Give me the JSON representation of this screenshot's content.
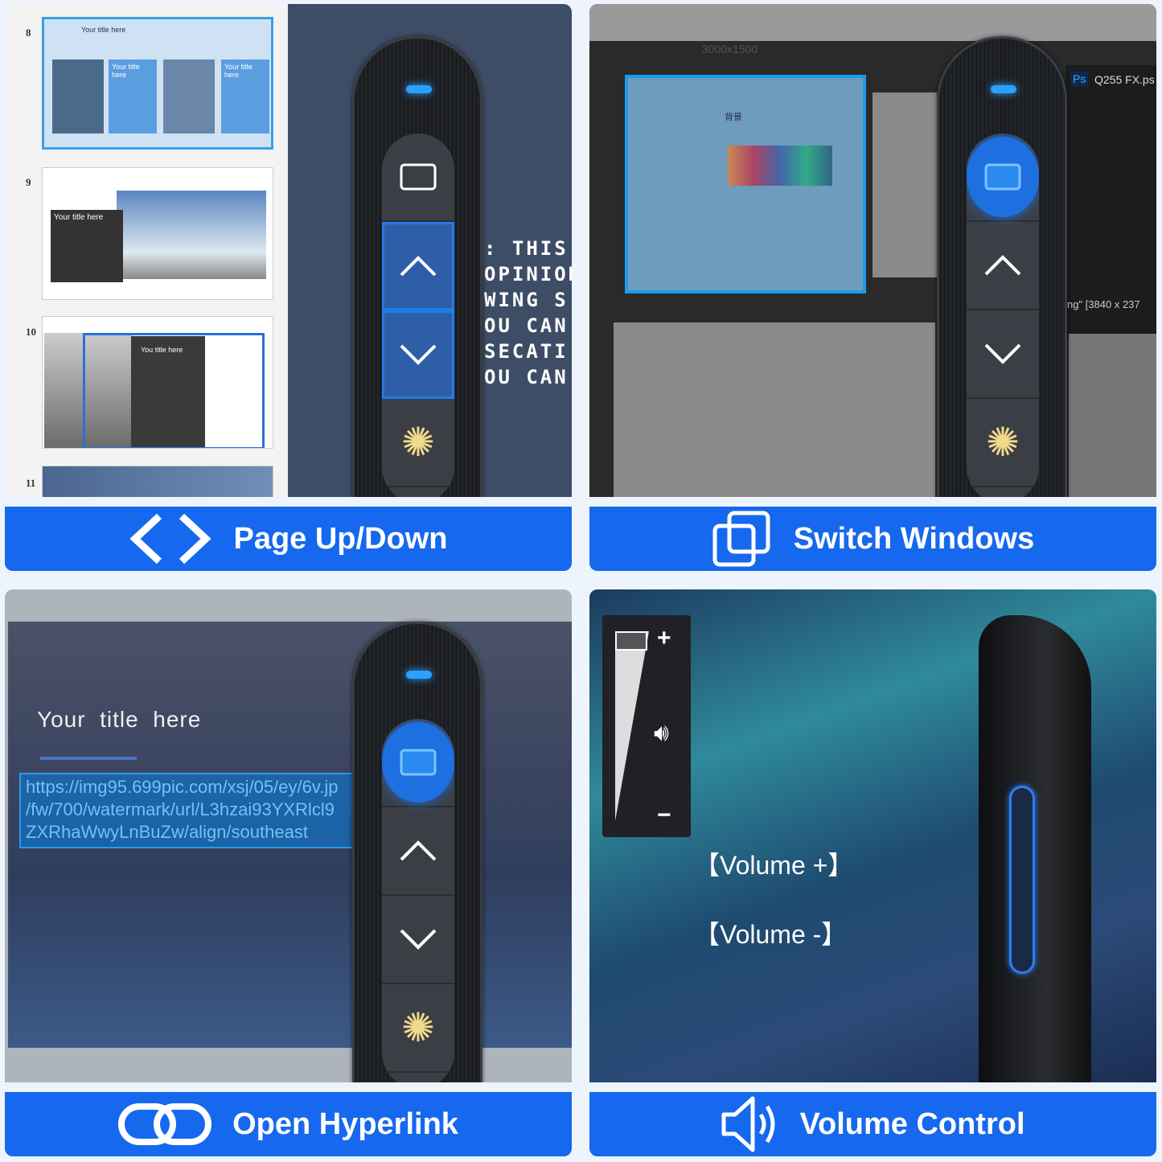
{
  "panels": {
    "page_updown": {
      "label": "Page Up/Down",
      "slide_numbers": [
        "8",
        "9",
        "10",
        "11"
      ],
      "slide8_title": "Your title here",
      "slide8_sub1": "Your title here",
      "slide8_sub2": "Your title here",
      "slide9_title": "Your title here",
      "slide10_title": "You title here",
      "background_text": [
        ": THIS F",
        "OPINION",
        "WING S",
        "OU CAN",
        "SECATI",
        "OU CAN"
      ]
    },
    "switch_windows": {
      "label": "Switch Windows",
      "resolution_text": "3000x1500",
      "ps_file": "Q255 FX.ps",
      "ps_badge": "Ps",
      "image_size": "ng\" [3840 x 237",
      "settings_heading": "背景"
    },
    "open_hyperlink": {
      "label": "Open Hyperlink",
      "slide_title": "Your  title  here",
      "url_lines": [
        "https://img95.699pic.com/xsj/05/ey/6v.jp",
        "/fw/700/watermark/url/L3hzai93YXRlcl9",
        "ZXRhaWwyLnBuZw/align/southeast"
      ]
    },
    "volume_control": {
      "label": "Volume Control",
      "volume_up": "【Volume +】",
      "volume_down": "【Volume -】",
      "plus": "+",
      "minus": "−",
      "volume_level": 0.9
    }
  },
  "colors": {
    "banner": "#1668ee",
    "background": "#eef4fb",
    "led": "#2aa0ff",
    "highlight": "#1e6fe0"
  }
}
